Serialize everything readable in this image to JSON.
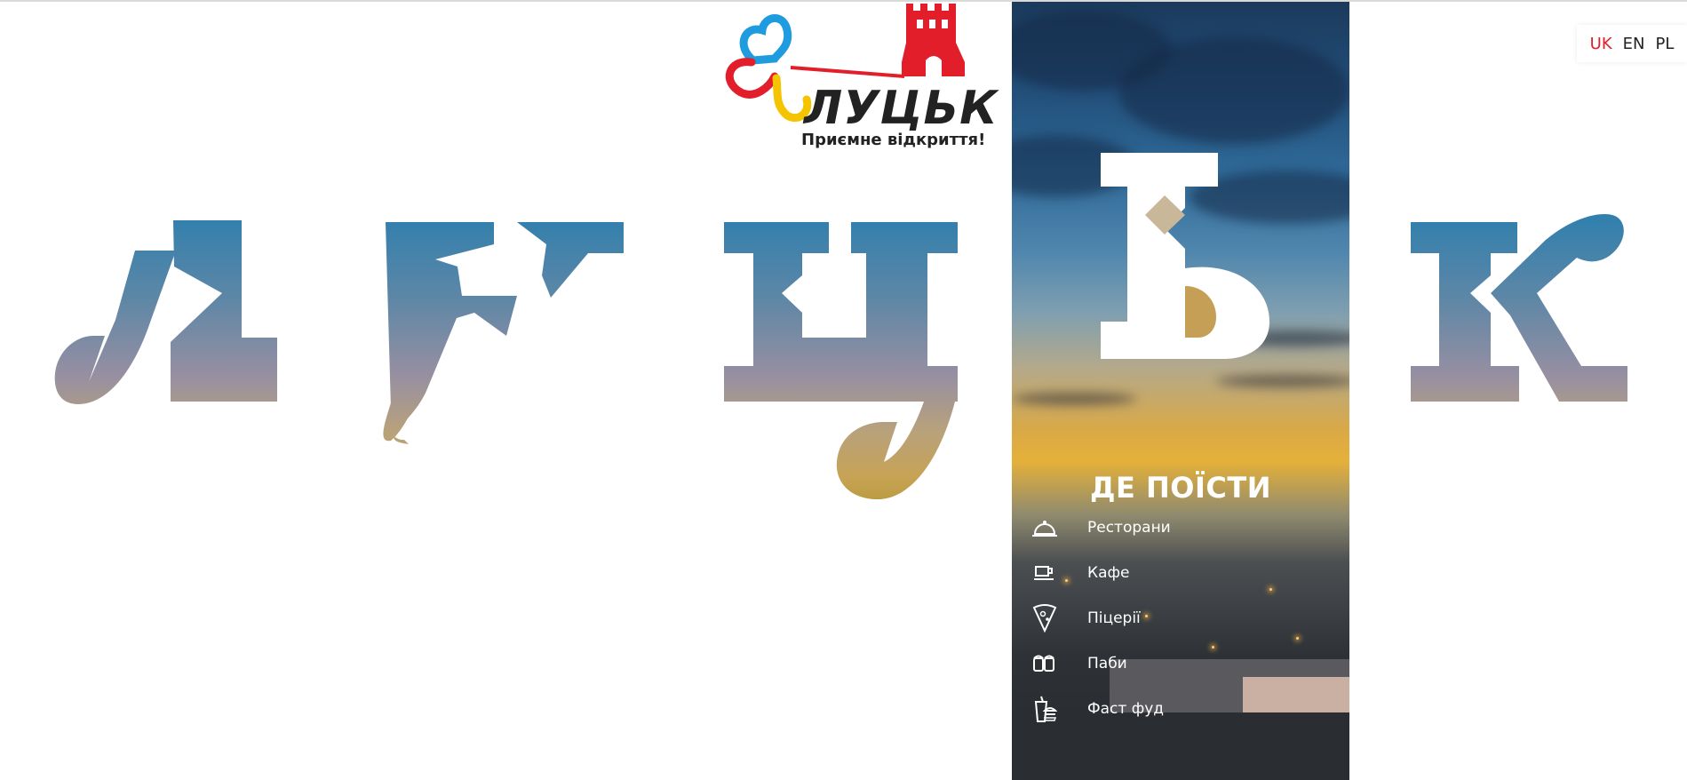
{
  "brand": {
    "name": "ЛУЦЬК",
    "tagline": "Приємне відкриття!"
  },
  "language_switcher": {
    "items": [
      {
        "label": "UK",
        "active": true
      },
      {
        "label": "EN",
        "active": false
      },
      {
        "label": "PL",
        "active": false
      }
    ]
  },
  "panel": {
    "title": "ДЕ ПОЇСТИ",
    "items": [
      {
        "label": "Ресторани",
        "icon": "cloche-icon"
      },
      {
        "label": "Кафе",
        "icon": "coffee-cup-icon"
      },
      {
        "label": "Піцерії",
        "icon": "pizza-slice-icon"
      },
      {
        "label": "Паби",
        "icon": "beer-mugs-icon"
      },
      {
        "label": "Фаст фуд",
        "icon": "fast-food-icon"
      }
    ]
  },
  "colors": {
    "accent_red": "#e21e2b",
    "logo_blue": "#1f9be0",
    "logo_yellow": "#f5c400",
    "text_dark": "#222222"
  }
}
